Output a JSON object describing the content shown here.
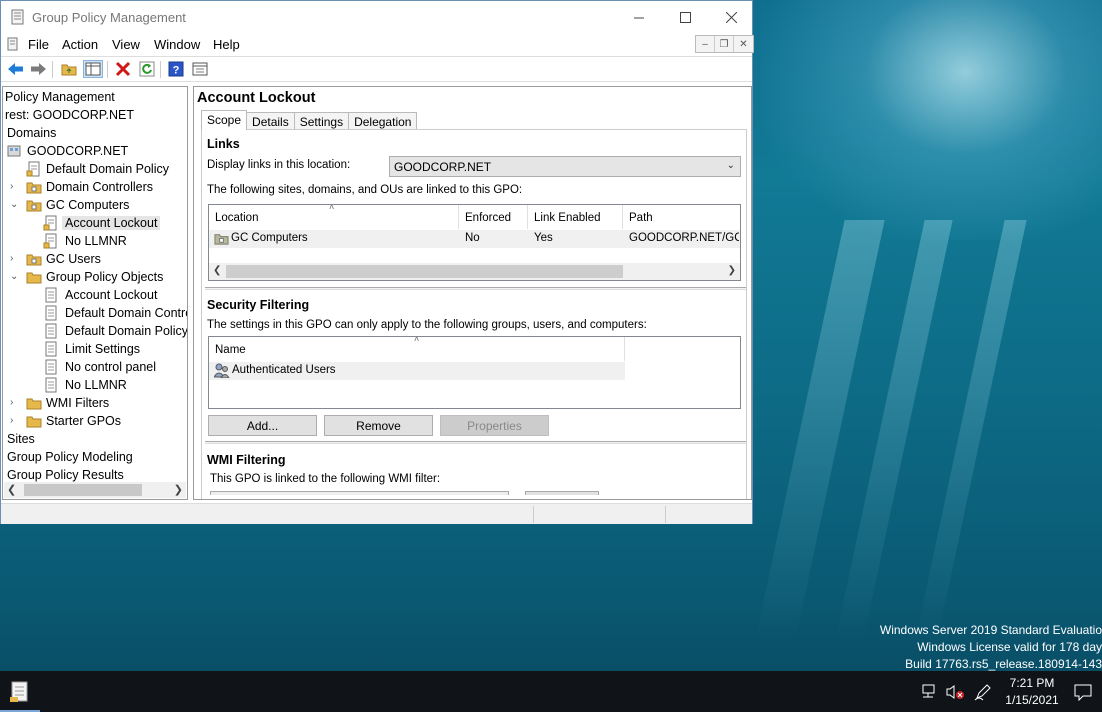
{
  "window": {
    "title": "Group Policy Management",
    "menu": [
      "File",
      "Action",
      "View",
      "Window",
      "Help"
    ]
  },
  "tree": {
    "items": [
      {
        "label": "Policy Management"
      },
      {
        "label": "rest: GOODCORP.NET"
      },
      {
        "label": "Domains"
      },
      {
        "label": "GOODCORP.NET"
      },
      {
        "label": "Default Domain Policy"
      },
      {
        "label": "Domain Controllers"
      },
      {
        "label": "GC Computers"
      },
      {
        "label": "Account Lockout"
      },
      {
        "label": "No LLMNR"
      },
      {
        "label": "GC Users"
      },
      {
        "label": "Group Policy Objects"
      },
      {
        "label": "Account Lockout"
      },
      {
        "label": "Default Domain Contro"
      },
      {
        "label": "Default Domain Policy"
      },
      {
        "label": "Limit Settings"
      },
      {
        "label": "No control panel"
      },
      {
        "label": "No LLMNR"
      },
      {
        "label": "WMI Filters"
      },
      {
        "label": "Starter GPOs"
      },
      {
        "label": "Sites"
      },
      {
        "label": "Group Policy Modeling"
      },
      {
        "label": "Group Policy Results"
      }
    ]
  },
  "detail": {
    "title": "Account Lockout",
    "tabs": [
      "Scope",
      "Details",
      "Settings",
      "Delegation"
    ],
    "links": {
      "heading": "Links",
      "location_label": "Display links in this location:",
      "location_value": "GOODCORP.NET",
      "linked_text": "The following sites, domains, and OUs are linked to this GPO:",
      "columns": [
        "Location",
        "Enforced",
        "Link Enabled",
        "Path"
      ],
      "rows": [
        {
          "location": "GC Computers",
          "enforced": "No",
          "link_enabled": "Yes",
          "path": "GOODCORP.NET/GC"
        }
      ]
    },
    "security": {
      "heading": "Security Filtering",
      "text": "The settings in this GPO can only apply to the following groups, users, and computers:",
      "columns": [
        "Name"
      ],
      "rows": [
        {
          "name": "Authenticated Users"
        }
      ],
      "buttons": {
        "add": "Add...",
        "remove": "Remove",
        "properties": "Properties"
      }
    },
    "wmi": {
      "heading": "WMI Filtering",
      "text": "This GPO is linked to the following WMI filter:"
    }
  },
  "desktop": {
    "watermark": [
      "Windows Server 2019 Standard Evaluatio",
      "Windows License valid for 178 day",
      "Build 17763.rs5_release.180914-143"
    ]
  },
  "taskbar": {
    "time": "7:21 PM",
    "date": "1/15/2021"
  },
  "icons": {
    "back": "back-arrow-icon",
    "forward": "forward-arrow-icon",
    "delete": "delete-x-icon",
    "refresh": "refresh-icon",
    "help": "help-icon"
  },
  "colors": {
    "selection": "#e5e5e5",
    "back_arrow": "#1e7bd6",
    "delete": "#d01818",
    "refresh": "#2a9a2a",
    "folder": "#e6b84a",
    "taskbar": "#101418"
  }
}
